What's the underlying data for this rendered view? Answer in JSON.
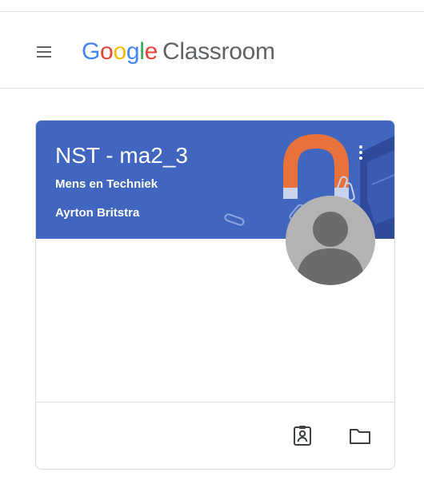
{
  "header": {
    "menu_icon": "hamburger-menu-icon",
    "brand_google_letters": [
      {
        "char": "G",
        "color": "#4285F4"
      },
      {
        "char": "o",
        "color": "#EA4335"
      },
      {
        "char": "o",
        "color": "#FBBC05"
      },
      {
        "char": "g",
        "color": "#4285F4"
      },
      {
        "char": "l",
        "color": "#34A853"
      },
      {
        "char": "e",
        "color": "#EA4335"
      }
    ],
    "brand_product": "Classroom"
  },
  "course_card": {
    "title": "NST - ma2_3",
    "section": "Mens en Techniek",
    "teacher": "Ayrton Britstra",
    "banner_color": "#4166C0",
    "more_icon": "more-vert-icon",
    "avatar_icon": "default-avatar-icon",
    "footer_icons": [
      "assignment-ind-icon",
      "folder-icon"
    ]
  }
}
